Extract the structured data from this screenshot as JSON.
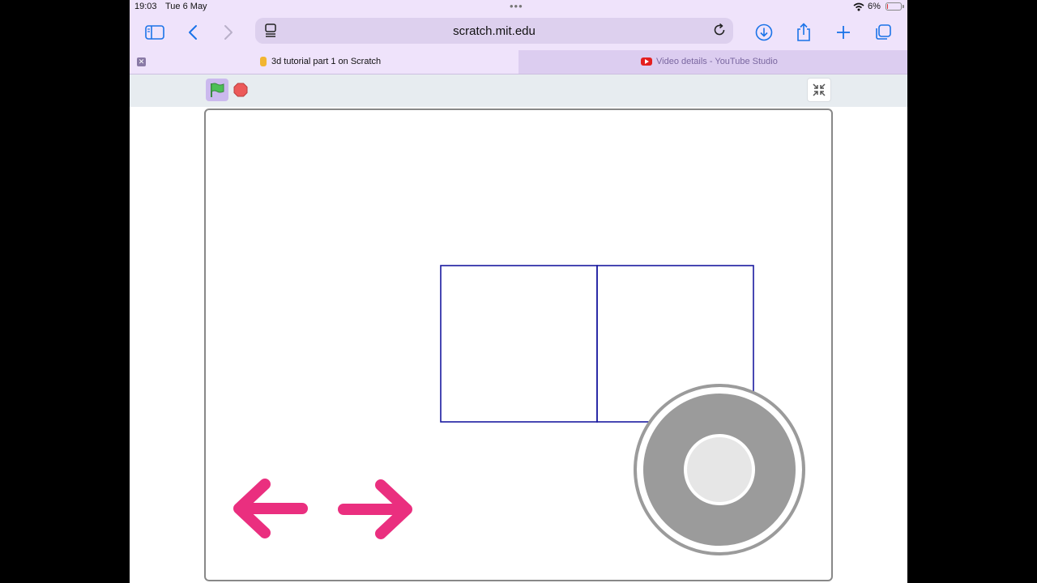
{
  "status_bar": {
    "time": "19:03",
    "date": "Tue 6 May",
    "battery_percent": "6%",
    "battery_level": 0.06
  },
  "toolbar": {
    "url": "scratch.mit.edu",
    "icons": [
      "sidebar-icon",
      "back-icon",
      "forward-icon",
      "reader-icon",
      "reload-icon",
      "download-icon",
      "share-icon",
      "new-tab-icon",
      "tabs-overview-icon"
    ]
  },
  "tabs": [
    {
      "title": "3d tutorial part 1 on Scratch",
      "active": true
    },
    {
      "title": "Video details - YouTube Studio",
      "active": false
    }
  ],
  "scratch": {
    "controls": [
      "green-flag-icon",
      "stop-icon",
      "exit-fullscreen-icon"
    ],
    "colors": {
      "flag": "#4cbf56",
      "stop": "#ec5959",
      "arrows": "#ea2f7f",
      "lines": "#1a1aa0",
      "joystick": "#9b9b9b"
    }
  }
}
